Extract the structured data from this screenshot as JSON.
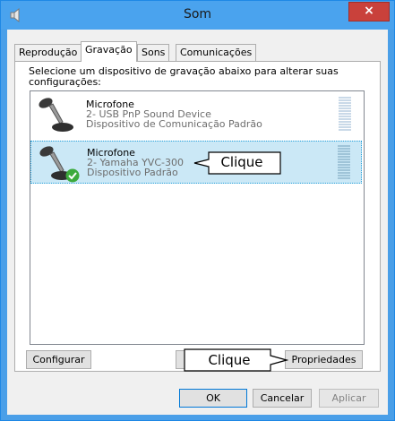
{
  "window": {
    "title": "Som",
    "close_label": "×"
  },
  "tabs": [
    {
      "label": "Reprodução"
    },
    {
      "label": "Gravação"
    },
    {
      "label": "Sons"
    },
    {
      "label": "Comunicações"
    }
  ],
  "instruction": "Selecione um dispositivo de gravação abaixo para alterar suas configurações:",
  "devices": [
    {
      "name": "Microfone",
      "subtitle": "2- USB PnP Sound Device",
      "status": "Dispositivo de Comunicação Padrão",
      "selected": false
    },
    {
      "name": "Microfone",
      "subtitle": "2- Yamaha YVC-300",
      "status": "Dispositivo Padrão",
      "selected": true
    }
  ],
  "callouts": {
    "top": "Clique",
    "bottom": "Clique"
  },
  "panel_buttons": {
    "configure": "Configurar",
    "properties": "Propriedades"
  },
  "dialog_buttons": {
    "ok": "OK",
    "cancel": "Cancelar",
    "apply": "Aplicar"
  },
  "colors": {
    "accent": "#4aa3ee",
    "selection": "#cbe8f6",
    "close": "#c9413b",
    "check": "#3caa3c"
  }
}
